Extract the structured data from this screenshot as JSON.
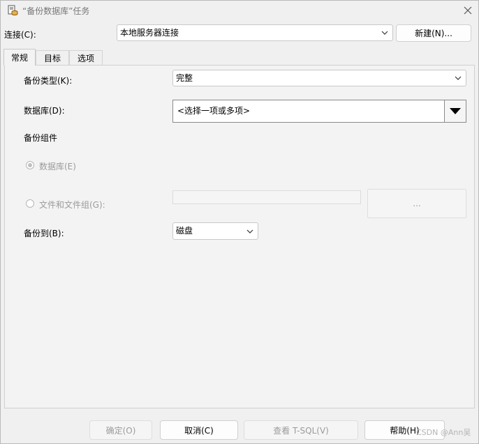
{
  "window": {
    "title": "“备份数据库”任务",
    "app_icon": "database-backup-icon",
    "close_icon": "close-icon"
  },
  "connection": {
    "label": "连接(C):",
    "value": "本地服务器连接",
    "new_button": "新建(N)..."
  },
  "tabs": [
    {
      "label": "常规",
      "active": true
    },
    {
      "label": "目标",
      "active": false
    },
    {
      "label": "选项",
      "active": false
    }
  ],
  "general": {
    "backup_type_label": "备份类型(K):",
    "backup_type_value": "完整",
    "database_label": "数据库(D):",
    "database_value": "<选择一项或多项>",
    "component_group_label": "备份组件",
    "radio_database_label": "数据库(E)",
    "radio_database_checked": true,
    "radio_files_label": "文件和文件组(G):",
    "radio_files_checked": false,
    "files_browse_button": "...",
    "backup_to_label": "备份到(B):",
    "backup_to_value": "磁盘"
  },
  "footer": {
    "ok_button": "确定(O)",
    "cancel_button": "取消(C)",
    "view_tsql_button": "查看 T-SQL(V)",
    "help_button": "帮助(H)"
  },
  "watermark": "CSDN @Ann吴"
}
